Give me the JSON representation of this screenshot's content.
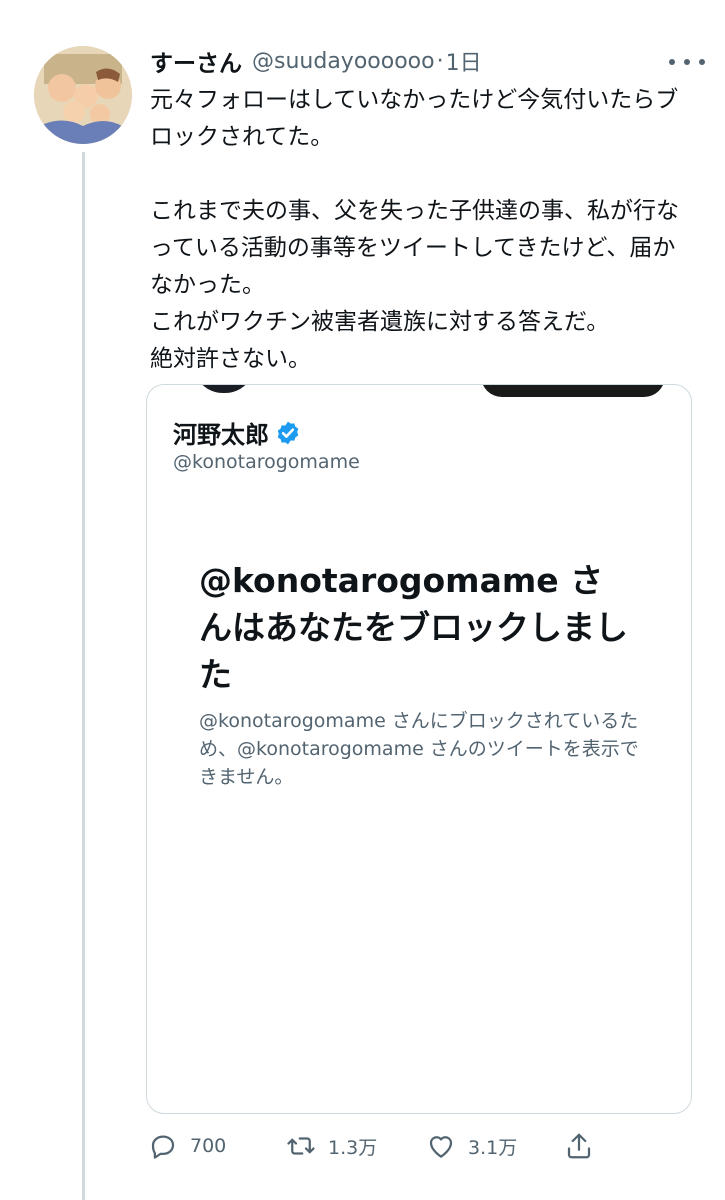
{
  "tweet": {
    "display_name": "すーさん",
    "handle": "@suudayoooooo",
    "separator": "·",
    "time": "1日",
    "text": "元々フォローはしていなかったけど今気付いたらブロックされてた。\n\nこれまで夫の事、父を失った子供達の事、私が行なっている活動の事等をツイートしてきたけど、届かなかった。\nこれがワクチン被害者遺族に対する答えだ。\n絶対許さない。"
  },
  "card": {
    "name": "河野太郎",
    "handle": "@konotarogomame",
    "blocked_title": "@konotarogomame さんはあなたをブロックしました",
    "blocked_description": "@konotarogomame さんにブロックされているため、@konotarogomame さんのツイートを表示できません。"
  },
  "actions": {
    "reply_count": "700",
    "retweet_count": "1.3万",
    "like_count": "3.1万"
  },
  "colors": {
    "text_primary": "#0f1419",
    "text_secondary": "#536471",
    "verified_blue": "#1d9bf0",
    "border": "#cfd9de"
  },
  "icons": [
    "more-icon",
    "verified-icon",
    "reply-icon",
    "retweet-icon",
    "like-icon",
    "share-icon"
  ]
}
